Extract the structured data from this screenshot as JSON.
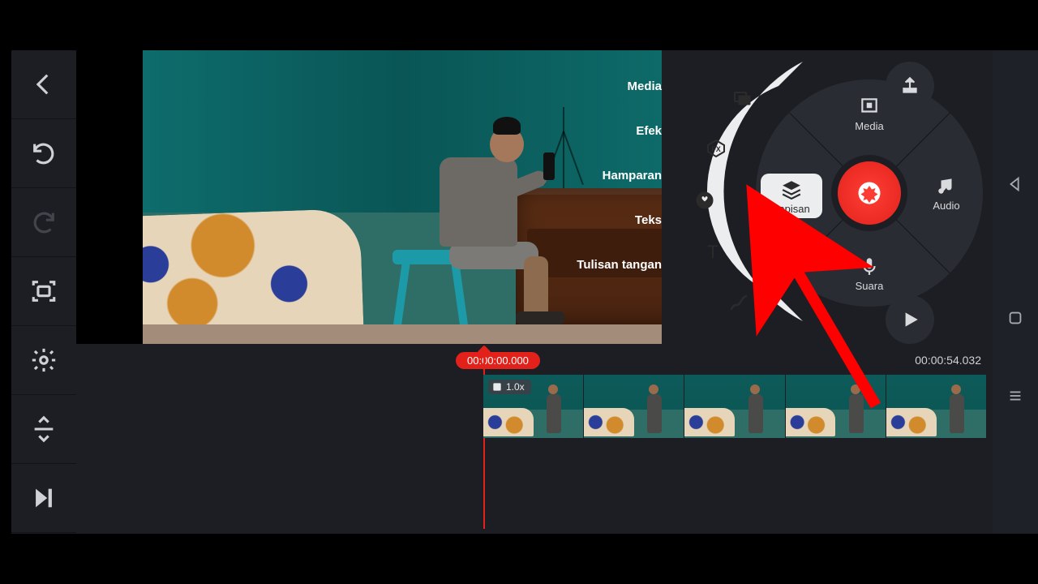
{
  "left_toolbar": {
    "back": "Back",
    "undo": "Undo",
    "redo": "Redo",
    "capture": "Capture",
    "settings": "Settings",
    "timeline_adjust": "Timeline",
    "jump_end": "Jump to end"
  },
  "fan_menu": {
    "labels": {
      "media": "Media",
      "efek": "Efek",
      "hamparan": "Hamparan",
      "teks": "Teks",
      "tulisan": "Tulisan tangan"
    }
  },
  "wheel": {
    "media": "Media",
    "lapisan": "Lapisan",
    "audio": "Audio",
    "suara": "Suara"
  },
  "corner": {
    "share": "Share",
    "play": "Play"
  },
  "timeline": {
    "current": "00:00:00.000",
    "duration": "00:00:54.032",
    "clip_speed": "1.0x"
  },
  "nav": {
    "back": "Back",
    "home": "Home",
    "recent": "Recent"
  },
  "colors": {
    "accent": "#e2221a"
  }
}
